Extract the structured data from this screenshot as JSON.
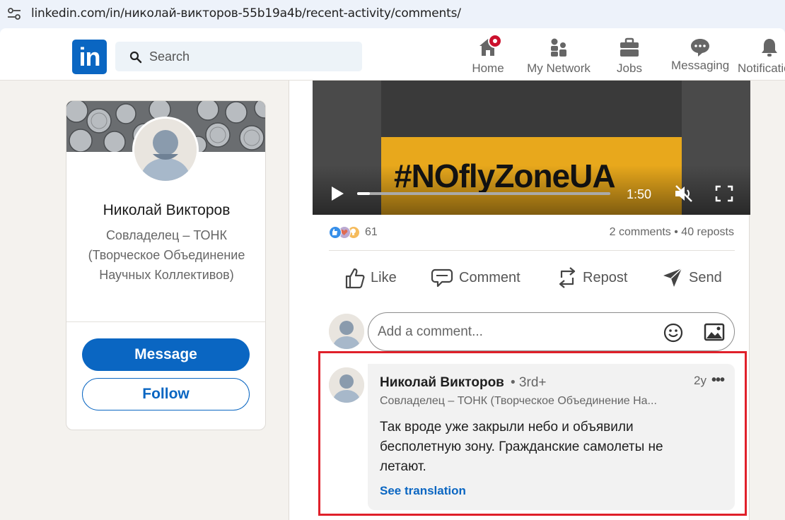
{
  "browser": {
    "url": "linkedin.com/in/николай-викторов-55b19a4b/recent-activity/comments/"
  },
  "header": {
    "logo_text": "in",
    "search_placeholder": "Search",
    "nav": [
      {
        "label": "Home",
        "icon": "home-icon"
      },
      {
        "label": "My Network",
        "icon": "people-icon"
      },
      {
        "label": "Jobs",
        "icon": "briefcase-icon"
      },
      {
        "label": "Messaging",
        "icon": "chat-icon"
      },
      {
        "label": "Notifications",
        "icon": "bell-icon"
      }
    ]
  },
  "profile": {
    "name": "Николай Викторов",
    "headline": "Совладелец – ТОНК (Творческое Объединение Научных Коллективов)",
    "message_label": "Message",
    "follow_label": "Follow"
  },
  "post": {
    "video_text": "#NOflyZoneUA",
    "video_time": "1:50",
    "video_progress": 0.05,
    "reaction_count": "61",
    "stats": "2 comments • 40 reposts",
    "actions": {
      "like": "Like",
      "comment": "Comment",
      "repost": "Repost",
      "send": "Send"
    },
    "comment_placeholder": "Add a comment..."
  },
  "comment": {
    "author": "Николай Викторов",
    "degree": "• 3rd+",
    "time": "2y",
    "more": "•••",
    "headline": "Совладелец – ТОНК (Творческое Объединение На...",
    "text": "Так вроде уже закрыли небо и объявили бесполетную зону. Гражданские самолеты не летают.",
    "translate_label": "See translation"
  },
  "colors": {
    "brand": "#0a66c2",
    "highlight": "#e0202a",
    "notification_badge": "#cb112d"
  }
}
